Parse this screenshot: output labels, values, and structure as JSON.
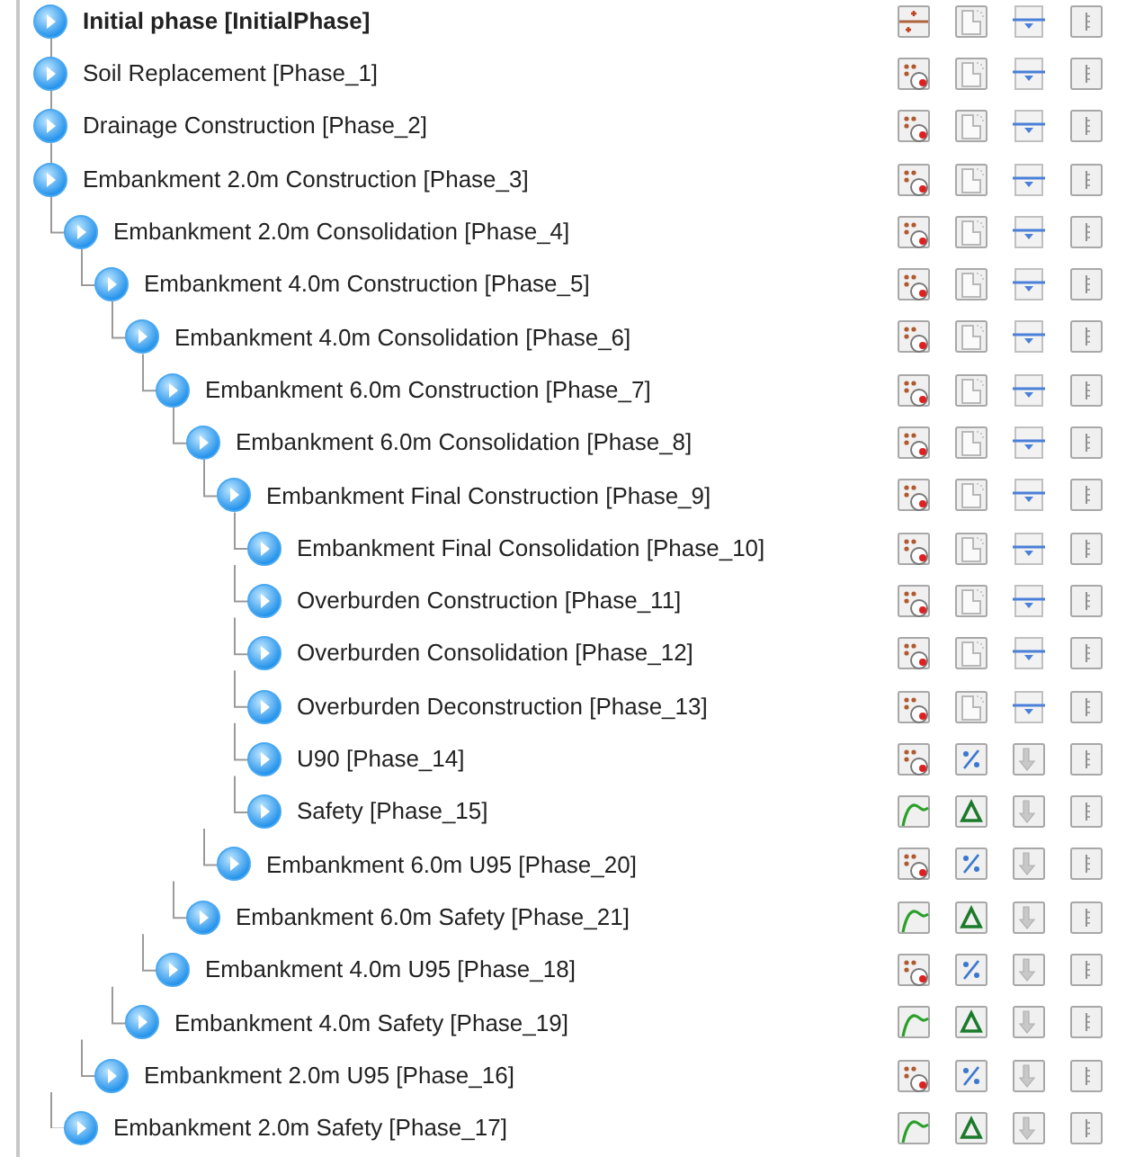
{
  "phases": [
    {
      "label": "Initial phase [InitialPhase]",
      "bold": true,
      "icons": [
        {
          "kind": "initial"
        },
        {
          "kind": "page"
        },
        {
          "kind": "water"
        },
        {
          "kind": "thermo"
        }
      ]
    },
    {
      "label": "Soil Replacement [Phase_1]",
      "bold": false,
      "icons": [
        {
          "kind": "staged"
        },
        {
          "kind": "page"
        },
        {
          "kind": "water"
        },
        {
          "kind": "thermo"
        }
      ]
    },
    {
      "label": "Drainage Construction [Phase_2]",
      "bold": false,
      "icons": [
        {
          "kind": "staged"
        },
        {
          "kind": "page"
        },
        {
          "kind": "water"
        },
        {
          "kind": "thermo"
        }
      ]
    },
    {
      "label": "Embankment 2.0m Construction [Phase_3]",
      "bold": false,
      "icons": [
        {
          "kind": "staged"
        },
        {
          "kind": "page"
        },
        {
          "kind": "water"
        },
        {
          "kind": "thermo"
        }
      ],
      "children": [
        {
          "label": "Embankment 2.0m Consolidation [Phase_4]",
          "bold": false,
          "icons": [
            {
              "kind": "staged"
            },
            {
              "kind": "page"
            },
            {
              "kind": "water"
            },
            {
              "kind": "thermo"
            }
          ],
          "children": [
            {
              "label": "Embankment 4.0m Construction [Phase_5]",
              "bold": false,
              "icons": [
                {
                  "kind": "staged"
                },
                {
                  "kind": "page"
                },
                {
                  "kind": "water"
                },
                {
                  "kind": "thermo"
                }
              ],
              "children": [
                {
                  "label": "Embankment 4.0m Consolidation [Phase_6]",
                  "bold": false,
                  "icons": [
                    {
                      "kind": "staged"
                    },
                    {
                      "kind": "page"
                    },
                    {
                      "kind": "water"
                    },
                    {
                      "kind": "thermo"
                    }
                  ],
                  "children": [
                    {
                      "label": "Embankment 6.0m Construction [Phase_7]",
                      "bold": false,
                      "icons": [
                        {
                          "kind": "staged"
                        },
                        {
                          "kind": "page"
                        },
                        {
                          "kind": "water"
                        },
                        {
                          "kind": "thermo"
                        }
                      ],
                      "children": [
                        {
                          "label": "Embankment 6.0m Consolidation [Phase_8]",
                          "bold": false,
                          "icons": [
                            {
                              "kind": "staged"
                            },
                            {
                              "kind": "page"
                            },
                            {
                              "kind": "water"
                            },
                            {
                              "kind": "thermo"
                            }
                          ],
                          "children": [
                            {
                              "label": "Embankment Final Construction [Phase_9]",
                              "bold": false,
                              "icons": [
                                {
                                  "kind": "staged"
                                },
                                {
                                  "kind": "page"
                                },
                                {
                                  "kind": "water"
                                },
                                {
                                  "kind": "thermo"
                                }
                              ],
                              "children": [
                                {
                                  "label": "Embankment Final Consolidation [Phase_10]",
                                  "bold": false,
                                  "icons": [
                                    {
                                      "kind": "staged"
                                    },
                                    {
                                      "kind": "page"
                                    },
                                    {
                                      "kind": "water"
                                    },
                                    {
                                      "kind": "thermo"
                                    }
                                  ]
                                },
                                {
                                  "label": "Overburden Construction [Phase_11]",
                                  "bold": false,
                                  "icons": [
                                    {
                                      "kind": "staged"
                                    },
                                    {
                                      "kind": "page"
                                    },
                                    {
                                      "kind": "water"
                                    },
                                    {
                                      "kind": "thermo"
                                    }
                                  ]
                                },
                                {
                                  "label": "Overburden Consolidation [Phase_12]",
                                  "bold": false,
                                  "icons": [
                                    {
                                      "kind": "staged"
                                    },
                                    {
                                      "kind": "page"
                                    },
                                    {
                                      "kind": "water"
                                    },
                                    {
                                      "kind": "thermo"
                                    }
                                  ]
                                },
                                {
                                  "label": "Overburden Deconstruction [Phase_13]",
                                  "bold": false,
                                  "icons": [
                                    {
                                      "kind": "staged"
                                    },
                                    {
                                      "kind": "page"
                                    },
                                    {
                                      "kind": "water"
                                    },
                                    {
                                      "kind": "thermo"
                                    }
                                  ]
                                },
                                {
                                  "label": "U90 [Phase_14]",
                                  "bold": false,
                                  "icons": [
                                    {
                                      "kind": "staged"
                                    },
                                    {
                                      "kind": "percent"
                                    },
                                    {
                                      "kind": "arrow"
                                    },
                                    {
                                      "kind": "thermo"
                                    }
                                  ]
                                },
                                {
                                  "label": "Safety [Phase_15]",
                                  "bold": false,
                                  "icons": [
                                    {
                                      "kind": "safety"
                                    },
                                    {
                                      "kind": "delta"
                                    },
                                    {
                                      "kind": "arrow"
                                    },
                                    {
                                      "kind": "thermo"
                                    }
                                  ]
                                }
                              ]
                            },
                            {
                              "label": "Embankment 6.0m U95 [Phase_20]",
                              "bold": false,
                              "icons": [
                                {
                                  "kind": "staged"
                                },
                                {
                                  "kind": "percent"
                                },
                                {
                                  "kind": "arrow"
                                },
                                {
                                  "kind": "thermo"
                                }
                              ]
                            }
                          ]
                        },
                        {
                          "label": "Embankment 6.0m Safety [Phase_21]",
                          "bold": false,
                          "icons": [
                            {
                              "kind": "safety"
                            },
                            {
                              "kind": "delta"
                            },
                            {
                              "kind": "arrow"
                            },
                            {
                              "kind": "thermo"
                            }
                          ]
                        }
                      ]
                    },
                    {
                      "label": "Embankment 4.0m U95 [Phase_18]",
                      "bold": false,
                      "icons": [
                        {
                          "kind": "staged"
                        },
                        {
                          "kind": "percent"
                        },
                        {
                          "kind": "arrow"
                        },
                        {
                          "kind": "thermo"
                        }
                      ]
                    }
                  ]
                },
                {
                  "label": "Embankment 4.0m Safety [Phase_19]",
                  "bold": false,
                  "icons": [
                    {
                      "kind": "safety"
                    },
                    {
                      "kind": "delta"
                    },
                    {
                      "kind": "arrow"
                    },
                    {
                      "kind": "thermo"
                    }
                  ]
                }
              ]
            },
            {
              "label": "Embankment 2.0m U95 [Phase_16]",
              "bold": false,
              "icons": [
                {
                  "kind": "staged"
                },
                {
                  "kind": "percent"
                },
                {
                  "kind": "arrow"
                },
                {
                  "kind": "thermo"
                }
              ]
            }
          ]
        },
        {
          "label": "Embankment 2.0m Safety [Phase_17]",
          "bold": false,
          "icons": [
            {
              "kind": "safety"
            },
            {
              "kind": "delta"
            },
            {
              "kind": "arrow"
            },
            {
              "kind": "thermo"
            }
          ]
        }
      ]
    }
  ]
}
